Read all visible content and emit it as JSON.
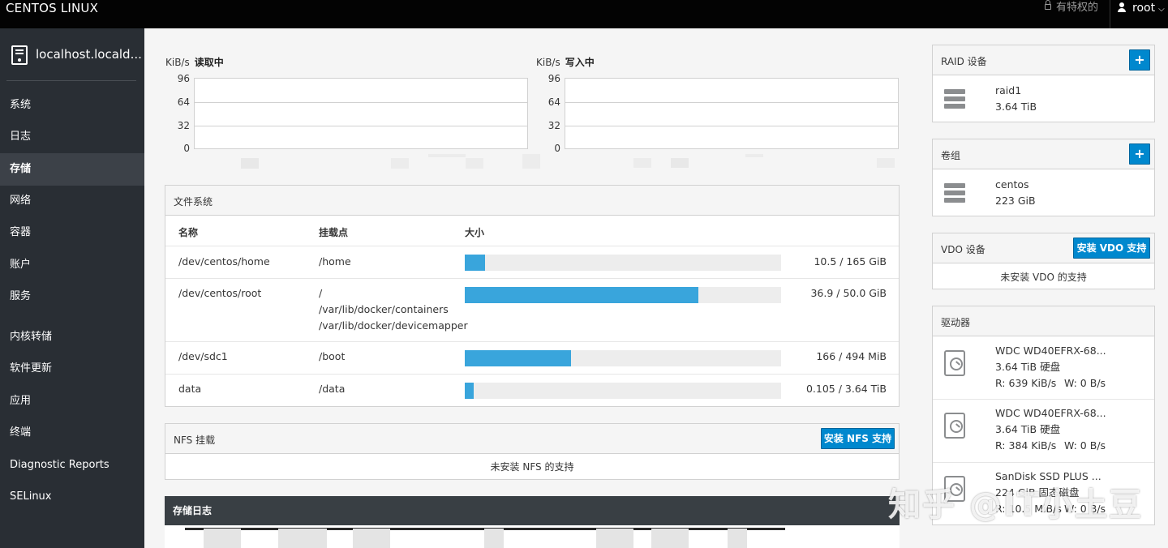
{
  "topbar": {
    "brand": "CENTOS LINUX",
    "privileged": "有特权的",
    "user": "root"
  },
  "sidebar": {
    "host": "localhost.locald...",
    "items": [
      {
        "label": "系统"
      },
      {
        "label": "日志"
      },
      {
        "label": "存储",
        "active": true
      },
      {
        "label": "网络"
      },
      {
        "label": "容器"
      },
      {
        "label": "账户"
      },
      {
        "label": "服务"
      },
      {
        "label": "内核转储"
      },
      {
        "label": "软件更新"
      },
      {
        "label": "应用"
      },
      {
        "label": "终端"
      },
      {
        "label": "Diagnostic Reports"
      },
      {
        "label": "SELinux"
      }
    ]
  },
  "charts": {
    "read": {
      "unit": "KiB/s",
      "title": "读取中",
      "ticks": [
        "96",
        "64",
        "32",
        "0"
      ]
    },
    "write": {
      "unit": "KiB/s",
      "title": "写入中",
      "ticks": [
        "96",
        "64",
        "32",
        "0"
      ]
    }
  },
  "filesystems": {
    "title": "文件系统",
    "headers": {
      "name": "名称",
      "mount": "挂载点",
      "size": "大小"
    },
    "rows": [
      {
        "name": "/dev/centos/home",
        "mount": [
          "/home"
        ],
        "size": "10.5 / 165 GiB",
        "fill": 0.064
      },
      {
        "name": "/dev/centos/root",
        "mount": [
          "/",
          "/var/lib/docker/containers",
          "/var/lib/docker/devicemapper"
        ],
        "size": "36.9 / 50.0 GiB",
        "fill": 0.738
      },
      {
        "name": "/dev/sdc1",
        "mount": [
          "/boot"
        ],
        "size": "166 / 494 MiB",
        "fill": 0.336
      },
      {
        "name": "data",
        "mount": [
          "/data"
        ],
        "size": "0.105 / 3.64 TiB",
        "fill": 0.029
      }
    ]
  },
  "nfs": {
    "title": "NFS 挂载",
    "button": "安装 NFS 支持",
    "empty": "未安装 NFS 的支持"
  },
  "log": {
    "title": "存储日志"
  },
  "raid": {
    "title": "RAID 设备",
    "add": "+",
    "name": "raid1",
    "size": "3.64 TiB"
  },
  "vg": {
    "title": "卷组",
    "add": "+",
    "name": "centos",
    "size": "223 GiB"
  },
  "vdo": {
    "title": "VDO 设备",
    "button": "安装 VDO 支持",
    "empty": "未安装 VDO 的支持"
  },
  "drives": {
    "title": "驱动器",
    "items": [
      {
        "name": "WDC WD40EFRX-68...",
        "desc": "3.64 TiB 硬盘",
        "r": "R: 639 KiB/s",
        "w": "W: 0 B/s"
      },
      {
        "name": "WDC WD40EFRX-68...",
        "desc": "3.64 TiB 硬盘",
        "r": "R: 384 KiB/s",
        "w": "W: 0 B/s"
      },
      {
        "name": "SanDisk SSD PLUS ...",
        "desc": "224 GiB 固态磁盘",
        "r": "R: 10.5 MiB/s",
        "w": "W: 0 B/s"
      }
    ]
  },
  "watermark": "知乎 @IT小土豆"
}
